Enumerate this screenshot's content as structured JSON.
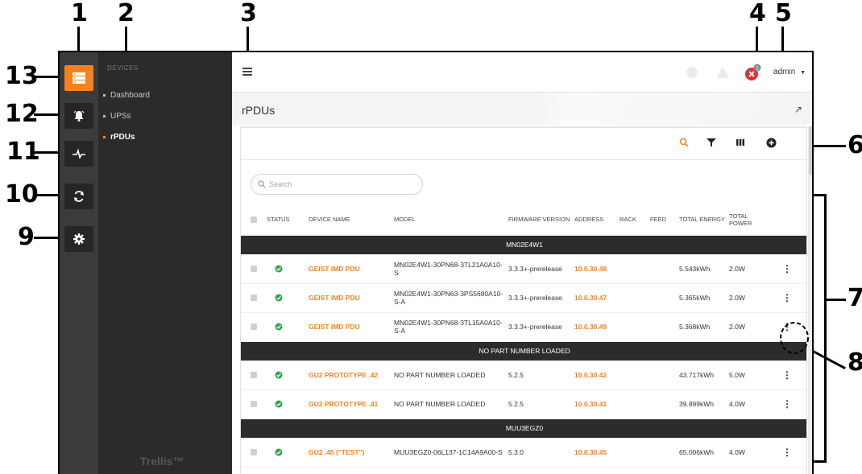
{
  "callouts": [
    "1",
    "2",
    "3",
    "4",
    "5",
    "6",
    "7",
    "8",
    "9",
    "10",
    "11",
    "12",
    "13"
  ],
  "rail": {
    "items": [
      {
        "icon": "server-icon",
        "active": true
      },
      {
        "icon": "alarm-bell-icon",
        "active": false
      },
      {
        "icon": "pulse-icon",
        "active": false
      },
      {
        "icon": "sync-icon",
        "active": false
      },
      {
        "icon": "gear-icon",
        "active": false
      }
    ]
  },
  "nav": {
    "section": "DEVICES",
    "items": [
      {
        "label": "Dashboard",
        "active": false
      },
      {
        "label": "UPSs",
        "active": false
      },
      {
        "label": "rPDUs",
        "active": true
      }
    ],
    "brand": "Trellis™"
  },
  "topbar": {
    "notification_badge": "1",
    "user": "admin"
  },
  "page": {
    "title": "rPDUs",
    "expand_icon": "↗"
  },
  "search": {
    "placeholder": "Search"
  },
  "table": {
    "headers": [
      "STATUS",
      "DEVICE NAME",
      "MODEL",
      "FIRMWARE VERSION",
      "ADDRESS",
      "RACK",
      "FEED",
      "TOTAL ENERGY",
      "TOTAL POWER"
    ],
    "groups": [
      {
        "name": "MN02E4W1",
        "rows": [
          {
            "device": "GEIST IMD PDU",
            "model": "MN02E4W1-30PN68-3TL21A0A10-S",
            "firmware": "3.3.3+-prerelease",
            "address": "10.0.30.48",
            "rack": "",
            "feed": "",
            "energy": "5.543kWh",
            "power": "2.0W"
          },
          {
            "device": "GEIST IMD PDU",
            "model": "MN02E4W1-30PN63-3PS5680A10-S-A",
            "firmware": "3.3.3+-prerelease",
            "address": "10.0.30.47",
            "rack": "",
            "feed": "",
            "energy": "5.365kWh",
            "power": "2.0W"
          },
          {
            "device": "GEIST IMD PDU",
            "model": "MN02E4W1-30PN68-3TL15A0A10-S-A",
            "firmware": "3.3.3+-prerelease",
            "address": "10.0.30.49",
            "rack": "",
            "feed": "",
            "energy": "5.368kWh",
            "power": "2.0W"
          }
        ]
      },
      {
        "name": "NO PART NUMBER LOADED",
        "rows": [
          {
            "device": "GU2 PROTOTYPE .42",
            "model": "NO PART NUMBER LOADED",
            "firmware": "5.2.5",
            "address": "10.0.30.42",
            "rack": "",
            "feed": "",
            "energy": "43.717kWh",
            "power": "5.0W"
          },
          {
            "device": "GU2 PROTOTYPE .41",
            "model": "NO PART NUMBER LOADED",
            "firmware": "5.2.5",
            "address": "10.0.30.41",
            "rack": "",
            "feed": "",
            "energy": "39.899kWh",
            "power": "4.0W"
          }
        ]
      },
      {
        "name": "MUU3EGZ0",
        "rows": [
          {
            "device": "GU2 .45 (\"TEST\")",
            "model": "MUU3EGZ0-06L137-1C14A9A00-S",
            "firmware": "5.3.0",
            "address": "10.0.30.45",
            "rack": "",
            "feed": "",
            "energy": "65.006kWh",
            "power": "4.0W"
          }
        ]
      }
    ]
  },
  "colors": {
    "accent": "#f58220",
    "status_ok": "#36a24a",
    "error": "#e02f2f",
    "rail_bg": "#3b3b3b",
    "nav_bg": "#2b2b2b",
    "group_bg": "#2c2c2c"
  }
}
